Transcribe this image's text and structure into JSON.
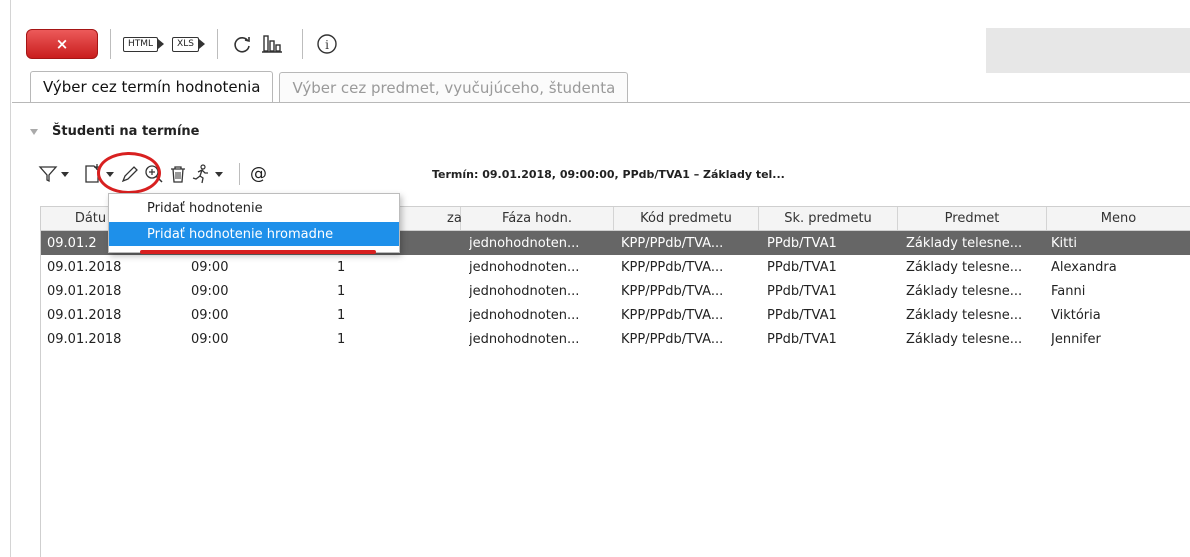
{
  "toolbar": {
    "close_label": "×",
    "html_label": "HTML",
    "xls_label": "XLS",
    "info_label": "i"
  },
  "tabs": [
    {
      "label": "Výber cez termín hodnotenia",
      "active": true
    },
    {
      "label": "Výber cez predmet, vyučujúceho, študenta",
      "active": false
    }
  ],
  "section": {
    "title": "Študenti na termíne",
    "at_label": "@",
    "term_info": "Termín: 09.01.2018, 09:00:00, PPdb/TVA1 – Základy tel..."
  },
  "table": {
    "headers": [
      "Dátu",
      "",
      "za",
      "Fáza hodn.",
      "Kód predmetu",
      "Sk. predmetu",
      "Predmet",
      "Meno"
    ],
    "rows": [
      [
        "09.01.2",
        "",
        "",
        "jednohodnoten...",
        "KPP/PPdb/TVA...",
        "PPdb/TVA1",
        "Základy telesne...",
        "Kitti"
      ],
      [
        "09.01.2018",
        "09:00",
        "1",
        "jednohodnoten...",
        "KPP/PPdb/TVA...",
        "PPdb/TVA1",
        "Základy telesne...",
        "Alexandra"
      ],
      [
        "09.01.2018",
        "09:00",
        "1",
        "jednohodnoten...",
        "KPP/PPdb/TVA...",
        "PPdb/TVA1",
        "Základy telesne...",
        "Fanni"
      ],
      [
        "09.01.2018",
        "09:00",
        "1",
        "jednohodnoten...",
        "KPP/PPdb/TVA...",
        "PPdb/TVA1",
        "Základy telesne...",
        "Viktória"
      ],
      [
        "09.01.2018",
        "09:00",
        "1",
        "jednohodnoten...",
        "KPP/PPdb/TVA...",
        "PPdb/TVA1",
        "Základy telesne...",
        "Jennifer"
      ]
    ]
  },
  "menu": {
    "items": [
      "Pridať hodnotenie",
      "Pridať hodnotenie hromadne"
    ]
  },
  "colors": {
    "close_red": "#d32f2f",
    "menu_highlight": "#1e90ea",
    "selected_row": "#666666",
    "annotation_red": "#d82020"
  }
}
